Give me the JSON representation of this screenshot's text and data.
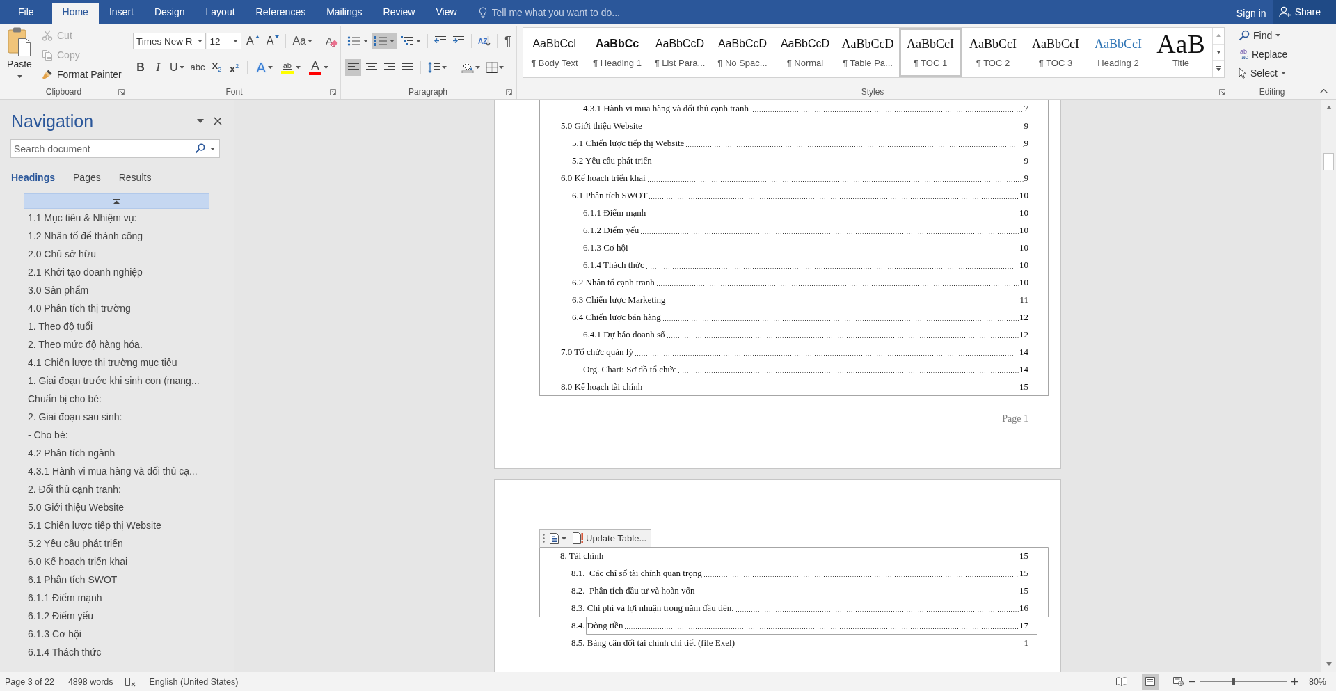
{
  "ribbon_tabs": [
    {
      "label": "File",
      "selected": false
    },
    {
      "label": "Home",
      "selected": true
    },
    {
      "label": "Insert",
      "selected": false
    },
    {
      "label": "Design",
      "selected": false
    },
    {
      "label": "Layout",
      "selected": false
    },
    {
      "label": "References",
      "selected": false
    },
    {
      "label": "Mailings",
      "selected": false
    },
    {
      "label": "Review",
      "selected": false
    },
    {
      "label": "View",
      "selected": false
    }
  ],
  "tell_me": {
    "placeholder": "Tell me what you want to do..."
  },
  "account": {
    "sign_in": "Sign in",
    "share": "Share"
  },
  "clipboard": {
    "label": "Clipboard",
    "paste": "Paste",
    "items": [
      {
        "kind": "cut",
        "label": "Cut",
        "disabled": true
      },
      {
        "kind": "copy",
        "label": "Copy",
        "disabled": true
      },
      {
        "kind": "painter",
        "label": "Format Painter",
        "disabled": false
      }
    ]
  },
  "font": {
    "label": "Font",
    "name": "Times New R",
    "size": "12",
    "size_buttons": [
      {
        "kind": "grow",
        "label": "A"
      },
      {
        "kind": "shrink",
        "label": "A"
      }
    ],
    "case_button": "Aa",
    "clear_button": "A",
    "format_buttons": [
      {
        "kind": "bold",
        "label": "B",
        "on": false
      },
      {
        "kind": "italic",
        "label": "I",
        "on": false
      },
      {
        "kind": "underline",
        "label": "U",
        "on": false
      },
      {
        "kind": "strike",
        "label": "abc",
        "on": false
      },
      {
        "kind": "subscript",
        "label": "x$_{2}$",
        "on": false
      },
      {
        "kind": "superscript",
        "label": "x$^{2}$",
        "on": false
      }
    ],
    "color_buttons": [
      {
        "kind": "effects",
        "label": "A"
      },
      {
        "kind": "highlight",
        "label": "ab",
        "color": "#ffff00"
      },
      {
        "kind": "fontcolor",
        "label": "A",
        "color": "#ff0000"
      }
    ]
  },
  "paragraph": {
    "label": "Paragraph",
    "list_buttons": [
      {
        "kind": "bullets",
        "selected": false
      },
      {
        "kind": "numbering",
        "selected": true
      },
      {
        "kind": "multilevel",
        "selected": false
      }
    ],
    "sort_label": "AZ",
    "marks_label": "¶",
    "align_buttons": [
      {
        "kind": "left",
        "selected": true
      },
      {
        "kind": "center",
        "selected": false
      },
      {
        "kind": "right",
        "selected": false
      },
      {
        "kind": "justify",
        "selected": false
      }
    ]
  },
  "styles": {
    "label": "Styles",
    "items": [
      {
        "kind": "sans",
        "preview": "AaBbCcI",
        "label": "¶ Body Text",
        "selected": false
      },
      {
        "kind": "bold",
        "preview": "AaBbCc",
        "label": "¶ Heading 1",
        "selected": false
      },
      {
        "kind": "sans",
        "preview": "AaBbCcD",
        "label": "¶ List Para...",
        "selected": false
      },
      {
        "kind": "sans",
        "preview": "AaBbCcD",
        "label": "¶ No Spac...",
        "selected": false
      },
      {
        "kind": "sans",
        "preview": "AaBbCcD",
        "label": "¶ Normal",
        "selected": false
      },
      {
        "kind": "serif",
        "preview": "AaBbCcD",
        "label": "¶ Table Pa...",
        "selected": false
      },
      {
        "kind": "serif",
        "preview": "AaBbCcI",
        "label": "¶ TOC 1",
        "selected": true
      },
      {
        "kind": "serif",
        "preview": "AaBbCcI",
        "label": "¶ TOC 2",
        "selected": false
      },
      {
        "kind": "serif",
        "preview": "AaBbCcI",
        "label": "¶ TOC 3",
        "selected": false
      },
      {
        "kind": "heading",
        "preview": "AaBbCcI",
        "label": "Heading 2",
        "selected": false
      },
      {
        "kind": "title",
        "preview": "AaB",
        "label": "Title",
        "selected": false
      }
    ]
  },
  "editing": {
    "label": "Editing",
    "items": [
      {
        "kind": "find",
        "label": "Find"
      },
      {
        "kind": "replace",
        "label": "Replace",
        "glyphs": [
          "ab",
          "ac"
        ]
      },
      {
        "kind": "select",
        "label": "Select"
      }
    ]
  },
  "navigation": {
    "title": "Navigation",
    "search": {
      "placeholder": "Search document"
    },
    "tabs": [
      {
        "label": "Headings",
        "selected": true
      },
      {
        "label": "Pages",
        "selected": false
      },
      {
        "label": "Results",
        "selected": false
      }
    ],
    "headings": [
      {
        "text": "1.1 Mục tiêu & Nhiệm vụ:",
        "selected": false
      },
      {
        "text": "1.2 Nhân tố để thành công",
        "selected": false
      },
      {
        "text": "2.0 Chủ sở hữu",
        "selected": false
      },
      {
        "text": "2.1 Khởi tạo doanh nghiệp",
        "selected": false
      },
      {
        "text": "3.0 Sản phẩm",
        "selected": false
      },
      {
        "text": "4.0 Phân tích thị trường",
        "selected": false
      },
      {
        "text": "1. Theo độ tuổi",
        "selected": false
      },
      {
        "text": "2. Theo mức độ hàng hóa.",
        "selected": false
      },
      {
        "text": "4.1 Chiến lược thi trường mục tiêu",
        "selected": false
      },
      {
        "text": "1. Giai đoạn trước khi sinh con (mang...",
        "selected": false
      },
      {
        "text": "Chuẩn bị cho bé:",
        "selected": false
      },
      {
        "text": "2. Giai đoạn sau sinh:",
        "selected": false
      },
      {
        "text": "- Cho bé:",
        "selected": false
      },
      {
        "text": "4.2 Phân tích ngành",
        "selected": false
      },
      {
        "text": "4.3.1 Hành vi mua hàng và đối thủ cạ...",
        "selected": false
      },
      {
        "text": "2. Đối thủ cạnh tranh:",
        "selected": false
      },
      {
        "text": "5.0 Giới thiệu Website",
        "selected": false
      },
      {
        "text": "5.1 Chiến lược tiếp thị Website",
        "selected": false
      },
      {
        "text": "5.2 Yêu cầu phát triển",
        "selected": false
      },
      {
        "text": "6.0 Kế hoạch triển khai",
        "selected": false
      },
      {
        "text": "6.1 Phân tích SWOT",
        "selected": false
      },
      {
        "text": "6.1.1 Điểm mạnh",
        "selected": false
      },
      {
        "text": "6.1.2 Điểm yếu",
        "selected": false
      },
      {
        "text": "6.1.3 Cơ hội",
        "selected": false
      },
      {
        "text": "6.1.4 Thách thức",
        "selected": false
      }
    ]
  },
  "document": {
    "pages": [
      {
        "toc": [
          {
            "children": [
              {
                "children": [
                  {
                    "text": "4.3.1 Hành vi mua hàng và đối thủ cạnh tranh",
                    "page": "7"
                  }
                ]
              }
            ]
          },
          {
            "text": "5.0 Giới thiệu Website",
            "page": "9",
            "children": [
              {
                "text": "5.1 Chiến lược tiếp thị Website",
                "page": "9"
              },
              {
                "text": "5.2 Yêu cầu phát triển",
                "page": "9"
              }
            ]
          },
          {
            "text": "6.0 Kế hoạch triển khai",
            "page": "9",
            "children": [
              {
                "text": "6.1 Phân tích SWOT",
                "page": "10",
                "children": [
                  {
                    "text": "6.1.1 Điểm mạnh",
                    "page": "10"
                  },
                  {
                    "text": "6.1.2 Điểm yếu",
                    "page": "10"
                  },
                  {
                    "text": "6.1.3 Cơ hội",
                    "page": "10"
                  },
                  {
                    "text": "6.1.4 Thách thức",
                    "page": "10"
                  }
                ]
              },
              {
                "text": "6.2 Nhân tố cạnh tranh",
                "page": "10"
              },
              {
                "text": "6.3 Chiến lược Marketing",
                "page": "11"
              },
              {
                "text": "6.4 Chiến lược bán hàng",
                "page": "12",
                "children": [
                  {
                    "text": "6.4.1 Dự báo doanh số",
                    "page": "12"
                  }
                ]
              }
            ]
          },
          {
            "text": "7.0 Tổ chức quản lý",
            "page": "14",
            "children": [
              {
                "children": [
                  {
                    "text": "Org. Chart: Sơ đồ tổ chức",
                    "page": "14"
                  }
                ]
              }
            ]
          },
          {
            "text": "8.0 Kế hoạch tài chính",
            "page": "15"
          }
        ],
        "footer": "Page 1"
      },
      {
        "toolbar": {
          "update_button": "Update Table..."
        },
        "toc": [
          {
            "text": "8. Tài chính",
            "page": "15",
            "children": [
              {
                "text": "8.1.  Các chỉ số tài chính quan trọng",
                "page": "15"
              },
              {
                "text": "8.2.  Phân tích đầu tư và hoàn vốn",
                "page": "15"
              },
              {
                "text": "8.3. Chi phí và lợi nhuận trong năm đầu tiên.",
                "page": "16"
              },
              {
                "text": "8.4. Dòng tiền",
                "page": "17"
              },
              {
                "text": "8.5. Bảng cân đối tài chính chi tiết (file Exel)",
                "page": "1"
              }
            ]
          }
        ]
      }
    ]
  },
  "status_bar": {
    "page": "Page 3 of 22",
    "words": "4898 words",
    "language": "English (United States)",
    "views": [
      {
        "kind": "read",
        "selected": false
      },
      {
        "kind": "print",
        "selected": true
      },
      {
        "kind": "web",
        "selected": false
      }
    ],
    "zoom": {
      "level": 0.39,
      "reading": "80%"
    }
  }
}
